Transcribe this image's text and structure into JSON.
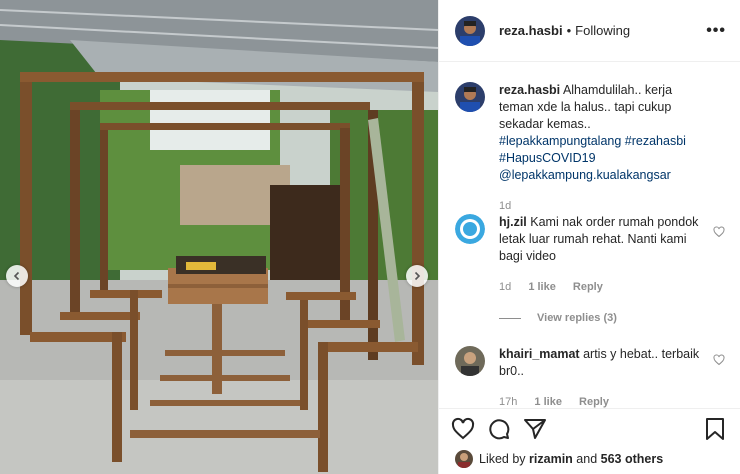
{
  "post": {
    "author": "reza.hasbi",
    "separator": "•",
    "follow_status": "Following",
    "more_icon": "more-icon"
  },
  "caption": {
    "username": "reza.hasbi",
    "text": "Alhamdulilah.. kerja teman xde la halus.. tapi cukup sekadar kemas..",
    "tags": "#lepakkampungtalang #rezahasbi #HapusCOVID19 @lepakkampung.kualakangsar",
    "time": "1d"
  },
  "comments": [
    {
      "username": "hj.zil",
      "text": "Kami nak order rumah pondok letak luar rumah rehat. Nanti kami bagi video",
      "time": "1d",
      "likes": "1 like",
      "reply": "Reply",
      "view_replies": "View replies (3)"
    },
    {
      "username": "khairi_mamat",
      "text": "artis y hebat.. terbaik br0..",
      "time": "17h",
      "likes": "1 like",
      "reply": "Reply"
    }
  ],
  "likes": {
    "prefix": "Liked by",
    "user": "rizamin",
    "middle": "and",
    "count": "563 others"
  },
  "colors": {
    "hashtag": "#003569",
    "meta": "#8e8e8e",
    "border": "#efefef"
  }
}
